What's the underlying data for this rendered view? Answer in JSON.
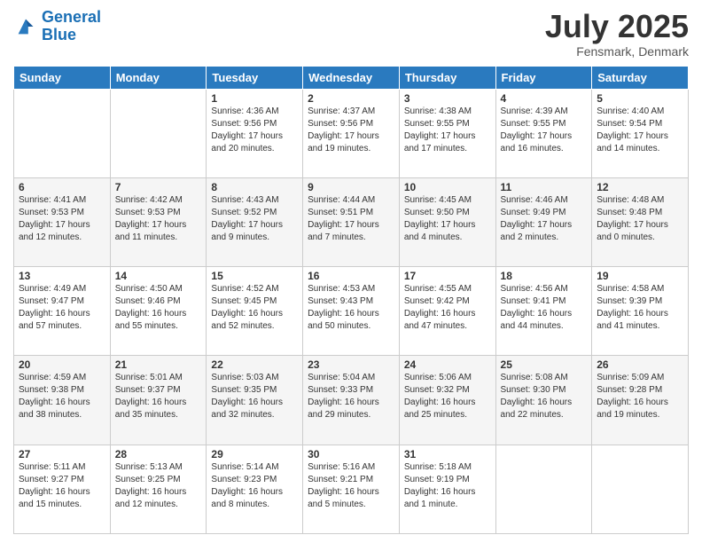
{
  "header": {
    "logo_line1": "General",
    "logo_line2": "Blue",
    "month_title": "July 2025",
    "location": "Fensmark, Denmark"
  },
  "days_of_week": [
    "Sunday",
    "Monday",
    "Tuesday",
    "Wednesday",
    "Thursday",
    "Friday",
    "Saturday"
  ],
  "weeks": [
    [
      {
        "day": "",
        "sunrise": "",
        "sunset": "",
        "daylight": ""
      },
      {
        "day": "",
        "sunrise": "",
        "sunset": "",
        "daylight": ""
      },
      {
        "day": "1",
        "sunrise": "Sunrise: 4:36 AM",
        "sunset": "Sunset: 9:56 PM",
        "daylight": "Daylight: 17 hours and 20 minutes."
      },
      {
        "day": "2",
        "sunrise": "Sunrise: 4:37 AM",
        "sunset": "Sunset: 9:56 PM",
        "daylight": "Daylight: 17 hours and 19 minutes."
      },
      {
        "day": "3",
        "sunrise": "Sunrise: 4:38 AM",
        "sunset": "Sunset: 9:55 PM",
        "daylight": "Daylight: 17 hours and 17 minutes."
      },
      {
        "day": "4",
        "sunrise": "Sunrise: 4:39 AM",
        "sunset": "Sunset: 9:55 PM",
        "daylight": "Daylight: 17 hours and 16 minutes."
      },
      {
        "day": "5",
        "sunrise": "Sunrise: 4:40 AM",
        "sunset": "Sunset: 9:54 PM",
        "daylight": "Daylight: 17 hours and 14 minutes."
      }
    ],
    [
      {
        "day": "6",
        "sunrise": "Sunrise: 4:41 AM",
        "sunset": "Sunset: 9:53 PM",
        "daylight": "Daylight: 17 hours and 12 minutes."
      },
      {
        "day": "7",
        "sunrise": "Sunrise: 4:42 AM",
        "sunset": "Sunset: 9:53 PM",
        "daylight": "Daylight: 17 hours and 11 minutes."
      },
      {
        "day": "8",
        "sunrise": "Sunrise: 4:43 AM",
        "sunset": "Sunset: 9:52 PM",
        "daylight": "Daylight: 17 hours and 9 minutes."
      },
      {
        "day": "9",
        "sunrise": "Sunrise: 4:44 AM",
        "sunset": "Sunset: 9:51 PM",
        "daylight": "Daylight: 17 hours and 7 minutes."
      },
      {
        "day": "10",
        "sunrise": "Sunrise: 4:45 AM",
        "sunset": "Sunset: 9:50 PM",
        "daylight": "Daylight: 17 hours and 4 minutes."
      },
      {
        "day": "11",
        "sunrise": "Sunrise: 4:46 AM",
        "sunset": "Sunset: 9:49 PM",
        "daylight": "Daylight: 17 hours and 2 minutes."
      },
      {
        "day": "12",
        "sunrise": "Sunrise: 4:48 AM",
        "sunset": "Sunset: 9:48 PM",
        "daylight": "Daylight: 17 hours and 0 minutes."
      }
    ],
    [
      {
        "day": "13",
        "sunrise": "Sunrise: 4:49 AM",
        "sunset": "Sunset: 9:47 PM",
        "daylight": "Daylight: 16 hours and 57 minutes."
      },
      {
        "day": "14",
        "sunrise": "Sunrise: 4:50 AM",
        "sunset": "Sunset: 9:46 PM",
        "daylight": "Daylight: 16 hours and 55 minutes."
      },
      {
        "day": "15",
        "sunrise": "Sunrise: 4:52 AM",
        "sunset": "Sunset: 9:45 PM",
        "daylight": "Daylight: 16 hours and 52 minutes."
      },
      {
        "day": "16",
        "sunrise": "Sunrise: 4:53 AM",
        "sunset": "Sunset: 9:43 PM",
        "daylight": "Daylight: 16 hours and 50 minutes."
      },
      {
        "day": "17",
        "sunrise": "Sunrise: 4:55 AM",
        "sunset": "Sunset: 9:42 PM",
        "daylight": "Daylight: 16 hours and 47 minutes."
      },
      {
        "day": "18",
        "sunrise": "Sunrise: 4:56 AM",
        "sunset": "Sunset: 9:41 PM",
        "daylight": "Daylight: 16 hours and 44 minutes."
      },
      {
        "day": "19",
        "sunrise": "Sunrise: 4:58 AM",
        "sunset": "Sunset: 9:39 PM",
        "daylight": "Daylight: 16 hours and 41 minutes."
      }
    ],
    [
      {
        "day": "20",
        "sunrise": "Sunrise: 4:59 AM",
        "sunset": "Sunset: 9:38 PM",
        "daylight": "Daylight: 16 hours and 38 minutes."
      },
      {
        "day": "21",
        "sunrise": "Sunrise: 5:01 AM",
        "sunset": "Sunset: 9:37 PM",
        "daylight": "Daylight: 16 hours and 35 minutes."
      },
      {
        "day": "22",
        "sunrise": "Sunrise: 5:03 AM",
        "sunset": "Sunset: 9:35 PM",
        "daylight": "Daylight: 16 hours and 32 minutes."
      },
      {
        "day": "23",
        "sunrise": "Sunrise: 5:04 AM",
        "sunset": "Sunset: 9:33 PM",
        "daylight": "Daylight: 16 hours and 29 minutes."
      },
      {
        "day": "24",
        "sunrise": "Sunrise: 5:06 AM",
        "sunset": "Sunset: 9:32 PM",
        "daylight": "Daylight: 16 hours and 25 minutes."
      },
      {
        "day": "25",
        "sunrise": "Sunrise: 5:08 AM",
        "sunset": "Sunset: 9:30 PM",
        "daylight": "Daylight: 16 hours and 22 minutes."
      },
      {
        "day": "26",
        "sunrise": "Sunrise: 5:09 AM",
        "sunset": "Sunset: 9:28 PM",
        "daylight": "Daylight: 16 hours and 19 minutes."
      }
    ],
    [
      {
        "day": "27",
        "sunrise": "Sunrise: 5:11 AM",
        "sunset": "Sunset: 9:27 PM",
        "daylight": "Daylight: 16 hours and 15 minutes."
      },
      {
        "day": "28",
        "sunrise": "Sunrise: 5:13 AM",
        "sunset": "Sunset: 9:25 PM",
        "daylight": "Daylight: 16 hours and 12 minutes."
      },
      {
        "day": "29",
        "sunrise": "Sunrise: 5:14 AM",
        "sunset": "Sunset: 9:23 PM",
        "daylight": "Daylight: 16 hours and 8 minutes."
      },
      {
        "day": "30",
        "sunrise": "Sunrise: 5:16 AM",
        "sunset": "Sunset: 9:21 PM",
        "daylight": "Daylight: 16 hours and 5 minutes."
      },
      {
        "day": "31",
        "sunrise": "Sunrise: 5:18 AM",
        "sunset": "Sunset: 9:19 PM",
        "daylight": "Daylight: 16 hours and 1 minute."
      },
      {
        "day": "",
        "sunrise": "",
        "sunset": "",
        "daylight": ""
      },
      {
        "day": "",
        "sunrise": "",
        "sunset": "",
        "daylight": ""
      }
    ]
  ]
}
